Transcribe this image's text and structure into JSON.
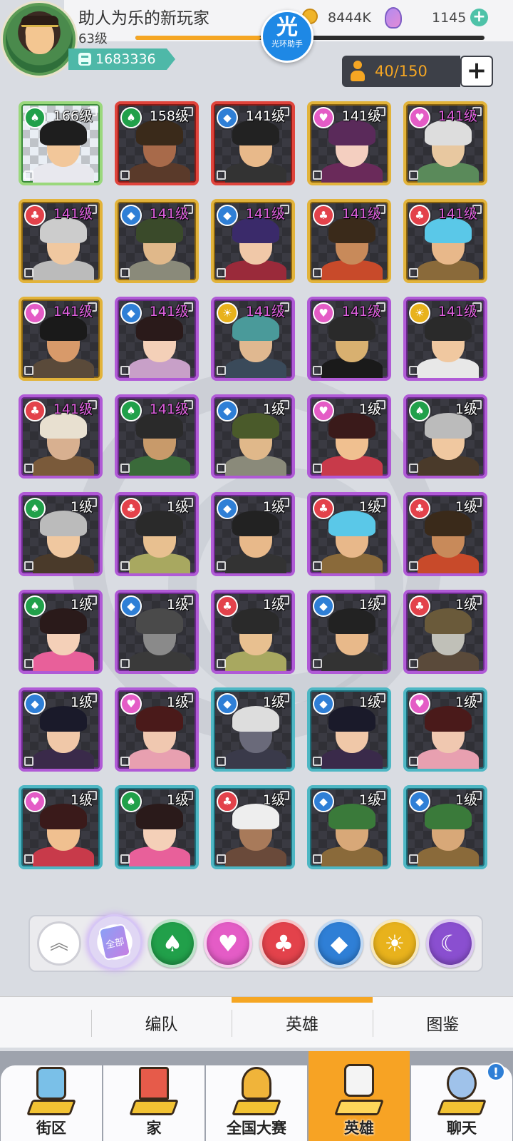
{
  "player": {
    "name": "助人为乐的新玩家",
    "level": "63级",
    "exp_fraction": 0.36,
    "power": "1683336"
  },
  "currency": {
    "gold": "8444K",
    "gems": "1145"
  },
  "halo_helper": {
    "main": "光",
    "sub": "光环助手"
  },
  "capacity": {
    "text": "40/150"
  },
  "suit_glyphs": {
    "spade": "♠",
    "heart": "♥",
    "club": "♣",
    "diamond": "◆",
    "sun": "☀",
    "moon": "☾"
  },
  "rarity_colors": {
    "red": "#e0443c",
    "gold": "#e2b33a",
    "purple": "#b05ad6",
    "teal": "#4eb7c4"
  },
  "heroes": [
    {
      "level": "166级",
      "suit": "spade",
      "rarity": "special"
    },
    {
      "level": "158级",
      "suit": "spade",
      "rarity": "red"
    },
    {
      "level": "141级",
      "suit": "diamond",
      "rarity": "red"
    },
    {
      "level": "141级",
      "suit": "heart",
      "rarity": "gold"
    },
    {
      "level": "141级",
      "suit": "heart",
      "rarity": "gold"
    },
    {
      "level": "141级",
      "suit": "club",
      "rarity": "gold"
    },
    {
      "level": "141级",
      "suit": "diamond",
      "rarity": "gold"
    },
    {
      "level": "141级",
      "suit": "diamond",
      "rarity": "gold"
    },
    {
      "level": "141级",
      "suit": "club",
      "rarity": "gold"
    },
    {
      "level": "141级",
      "suit": "club",
      "rarity": "gold"
    },
    {
      "level": "141级",
      "suit": "heart",
      "rarity": "gold"
    },
    {
      "level": "141级",
      "suit": "diamond",
      "rarity": "purple"
    },
    {
      "level": "141级",
      "suit": "sun",
      "rarity": "purple"
    },
    {
      "level": "141级",
      "suit": "heart",
      "rarity": "purple"
    },
    {
      "level": "141级",
      "suit": "sun",
      "rarity": "purple"
    },
    {
      "level": "141级",
      "suit": "club",
      "rarity": "purple"
    },
    {
      "level": "141级",
      "suit": "spade",
      "rarity": "purple"
    },
    {
      "level": "1级",
      "suit": "diamond",
      "rarity": "purple"
    },
    {
      "level": "1级",
      "suit": "heart",
      "rarity": "purple"
    },
    {
      "level": "1级",
      "suit": "spade",
      "rarity": "purple"
    },
    {
      "level": "1级",
      "suit": "spade",
      "rarity": "purple"
    },
    {
      "level": "1级",
      "suit": "club",
      "rarity": "purple"
    },
    {
      "level": "1级",
      "suit": "diamond",
      "rarity": "purple"
    },
    {
      "level": "1级",
      "suit": "club",
      "rarity": "purple"
    },
    {
      "level": "1级",
      "suit": "club",
      "rarity": "purple"
    },
    {
      "level": "1级",
      "suit": "spade",
      "rarity": "purple"
    },
    {
      "level": "1级",
      "suit": "diamond",
      "rarity": "purple"
    },
    {
      "level": "1级",
      "suit": "club",
      "rarity": "purple"
    },
    {
      "level": "1级",
      "suit": "diamond",
      "rarity": "purple"
    },
    {
      "level": "1级",
      "suit": "club",
      "rarity": "purple"
    },
    {
      "level": "1级",
      "suit": "diamond",
      "rarity": "purple"
    },
    {
      "level": "1级",
      "suit": "heart",
      "rarity": "purple"
    },
    {
      "level": "1级",
      "suit": "diamond",
      "rarity": "teal"
    },
    {
      "level": "1级",
      "suit": "diamond",
      "rarity": "teal"
    },
    {
      "level": "1级",
      "suit": "heart",
      "rarity": "teal"
    },
    {
      "level": "1级",
      "suit": "heart",
      "rarity": "teal"
    },
    {
      "level": "1级",
      "suit": "spade",
      "rarity": "teal"
    },
    {
      "level": "1级",
      "suit": "club",
      "rarity": "teal"
    },
    {
      "level": "1级",
      "suit": "diamond",
      "rarity": "teal"
    },
    {
      "level": "1级",
      "suit": "diamond",
      "rarity": "teal"
    }
  ],
  "filter_bar": {
    "all_label": "全部",
    "suits": [
      {
        "suit": "spade",
        "color": "#21a04a"
      },
      {
        "suit": "heart",
        "color": "#e45cc6"
      },
      {
        "suit": "club",
        "color": "#e3424b"
      },
      {
        "suit": "diamond",
        "color": "#2f7fd6"
      },
      {
        "suit": "sun",
        "color": "#e8b21c"
      },
      {
        "suit": "moon",
        "color": "#8a4fd0"
      }
    ]
  },
  "sub_tabs": {
    "formation": "编队",
    "heroes": "英雄",
    "codex": "图鉴"
  },
  "nav": {
    "street": "街区",
    "home": "家",
    "tournament": "全国大赛",
    "heroes": "英雄",
    "chat": "聊天",
    "chat_alert": "!"
  },
  "colors": {
    "accent": "#f5a623",
    "teal": "#4eb8a8"
  }
}
